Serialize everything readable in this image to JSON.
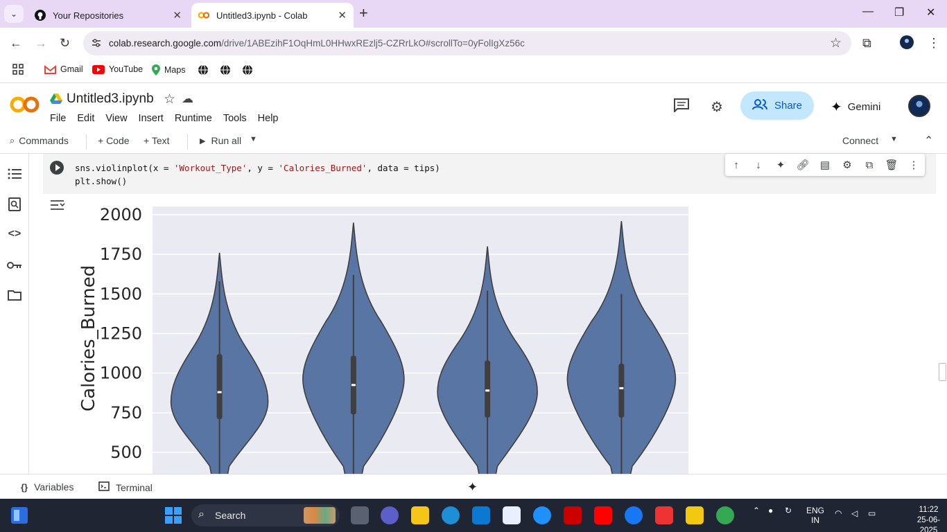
{
  "browser": {
    "tabs": [
      {
        "title": "Your Repositories",
        "icon": "github-icon",
        "active": false
      },
      {
        "title": "Untitled3.ipynb - Colab",
        "icon": "colab-icon",
        "active": true
      }
    ],
    "url_host": "colab.research.google.com",
    "url_path": "/drive/1ABEzihF1OqHmL0HHwxREzlj5-CZRrLkO#scrollTo=0yFolIgXz56c",
    "bookmarks": [
      {
        "label": "Gmail",
        "icon": "gmail-icon"
      },
      {
        "label": "YouTube",
        "icon": "youtube-icon"
      },
      {
        "label": "Maps",
        "icon": "maps-icon"
      }
    ]
  },
  "colab": {
    "notebook_title": "Untitled3.ipynb",
    "menu": [
      "File",
      "Edit",
      "View",
      "Insert",
      "Runtime",
      "Tools",
      "Help"
    ],
    "share_label": "Share",
    "gemini_label": "Gemini",
    "toolbar": {
      "commands": "Commands",
      "code": "+ Code",
      "text": "+ Text",
      "run_all": "Run all",
      "connect": "Connect"
    },
    "cell": {
      "line1_pre": "sns.violinplot(x = ",
      "line1_s1": "'Workout_Type'",
      "line1_mid": ", y = ",
      "line1_s2": "'Calories_Burned'",
      "line1_post": ", data = tips)",
      "line2": "plt.show()"
    },
    "bottom": {
      "variables": "Variables",
      "terminal": "Terminal"
    }
  },
  "chart_data": {
    "type": "violin",
    "ylabel": "Calories_Burned",
    "yticks": [
      500,
      750,
      1000,
      1250,
      1500,
      1750,
      2000
    ],
    "ylim_visible": [
      415,
      2050
    ],
    "grid": true,
    "series": [
      {
        "max": 1760,
        "q3": 1120,
        "median": 880,
        "q1": 710,
        "whisker_high": 1580,
        "widest_at": 820,
        "half_width": 70
      },
      {
        "max": 1950,
        "q3": 1110,
        "median": 925,
        "q1": 740,
        "whisker_high": 1620,
        "widest_at": 960,
        "half_width": 73
      },
      {
        "max": 1800,
        "q3": 1080,
        "median": 890,
        "q1": 720,
        "whisker_high": 1520,
        "widest_at": 880,
        "half_width": 72
      },
      {
        "max": 1960,
        "q3": 1060,
        "median": 905,
        "q1": 720,
        "whisker_high": 1500,
        "widest_at": 960,
        "half_width": 78
      }
    ],
    "color": "#5875a4"
  },
  "taskbar": {
    "search_label": "Search",
    "lang1": "ENG",
    "lang2": "IN",
    "time": "11:22",
    "date": "25-06-2025"
  }
}
